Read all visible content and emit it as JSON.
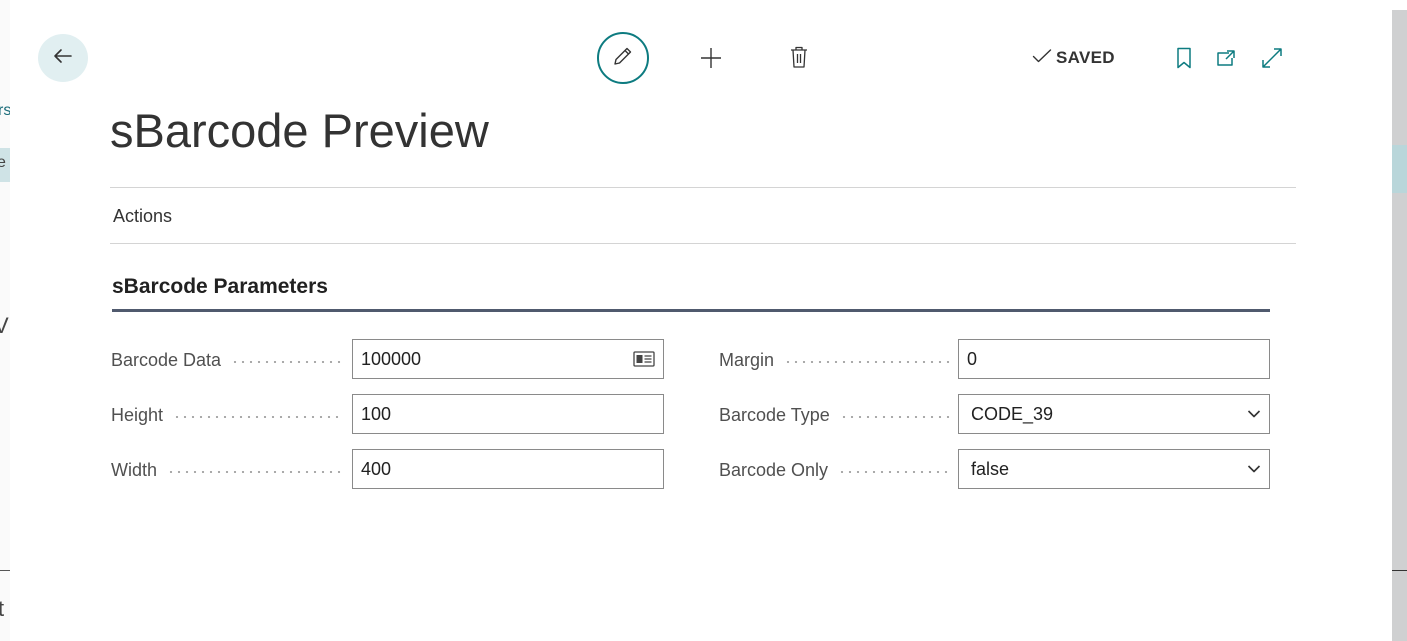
{
  "page": {
    "title": "sBarcode Preview"
  },
  "toolbar": {
    "saved_label": "SAVED"
  },
  "menu": {
    "actions_label": "Actions"
  },
  "section": {
    "title": "sBarcode Parameters"
  },
  "fields": {
    "barcode_data": {
      "label": "Barcode Data",
      "value": "100000"
    },
    "height": {
      "label": "Height",
      "value": "100"
    },
    "width": {
      "label": "Width",
      "value": "400"
    },
    "margin": {
      "label": "Margin",
      "value": "0"
    },
    "barcode_type": {
      "label": "Barcode Type",
      "value": "CODE_39"
    },
    "barcode_only": {
      "label": "Barcode Only",
      "value": "false"
    }
  },
  "background": {
    "chars": [
      "rs",
      "e",
      "V",
      "t"
    ]
  },
  "icons": {
    "back": "arrow-left-icon",
    "edit": "pencil-icon",
    "new": "plus-icon",
    "delete": "trash-icon",
    "saved": "checkmark-icon",
    "bookmark": "bookmark-icon",
    "open_new_window": "open-in-new-window-icon",
    "expand": "expand-icon",
    "lookup": "contact-card-icon",
    "dropdown": "chevron-down-icon"
  },
  "colors": {
    "accent": "#0d7b80",
    "back_button_bg": "#e1eff1",
    "section_underline": "#505a6e"
  }
}
